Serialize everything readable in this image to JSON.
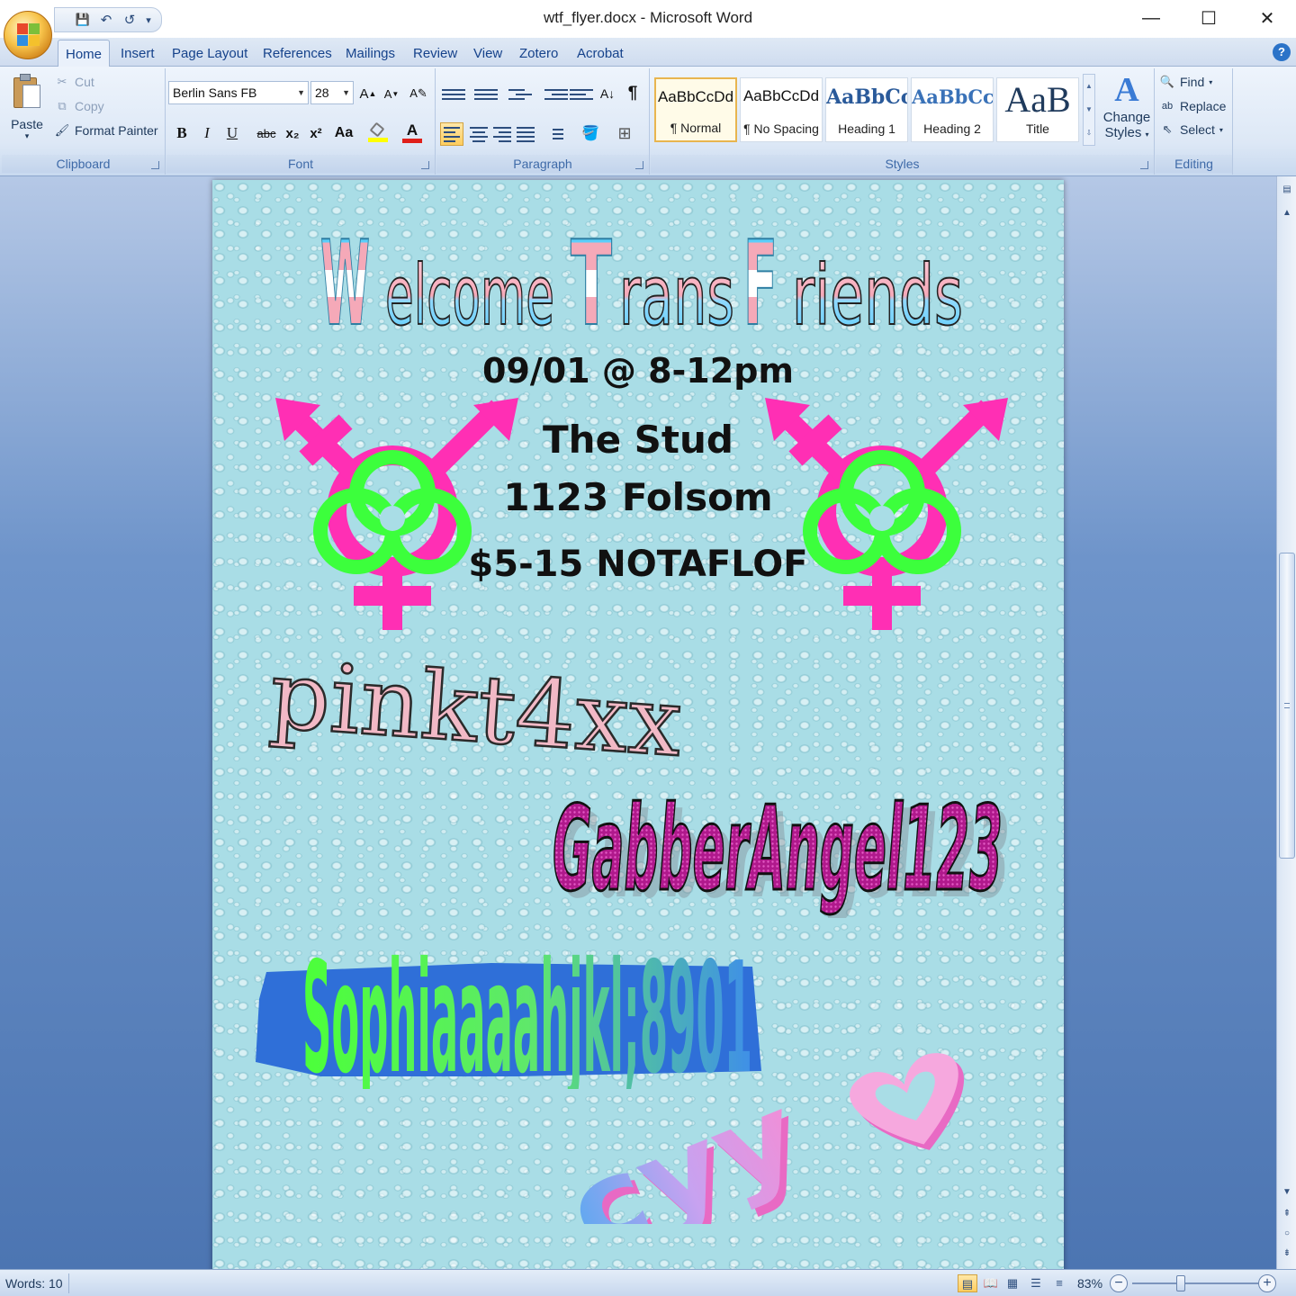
{
  "window": {
    "title": "wtf_flyer.docx - Microsoft Word",
    "minimize": "—",
    "maximize": "☐",
    "close": "✕"
  },
  "qat": {
    "save": "💾",
    "undo": "↶",
    "redo": "↺",
    "customize": "▾"
  },
  "tabs": [
    "Home",
    "Insert",
    "Page Layout",
    "References",
    "Mailings",
    "Review",
    "View",
    "Zotero",
    "Acrobat"
  ],
  "help_label": "?",
  "clipboard": {
    "paste": "Paste",
    "cut": "Cut",
    "copy": "Copy",
    "format_painter": "Format Painter",
    "group_label": "Clipboard"
  },
  "font": {
    "family": "Berlin Sans FB",
    "size": "28",
    "bold": "B",
    "italic": "I",
    "underline": "U",
    "strike": "abc",
    "subscript": "x₂",
    "superscript": "x²",
    "change_case": "Aa",
    "grow": "A",
    "shrink": "A",
    "group_label": "Font"
  },
  "paragraph": {
    "group_label": "Paragraph",
    "pilcrow": "¶"
  },
  "styles": {
    "group_label": "Styles",
    "items": [
      {
        "sample": "AaBbCcDd",
        "name": "¶ Normal"
      },
      {
        "sample": "AaBbCcDd",
        "name": "¶ No Spacing"
      },
      {
        "sample": "AaBbCc",
        "name": "Heading 1"
      },
      {
        "sample": "AaBbCc",
        "name": "Heading 2"
      },
      {
        "sample": "AaB",
        "name": "Title"
      }
    ],
    "change_styles_1": "Change",
    "change_styles_2": "Styles"
  },
  "editing": {
    "find": "Find",
    "replace": "Replace",
    "select": "Select",
    "group_label": "Editing"
  },
  "flyer": {
    "title_parts": [
      "W",
      "elcome ",
      "T",
      "rans ",
      "F",
      "riends"
    ],
    "date": "09/01 @ 8-12pm",
    "venue": "The Stud",
    "address": "1123 Folsom",
    "price": "$5-15 NOTAFLOF",
    "artists": [
      "pinkt4xx",
      "GabberAngel123",
      "Sophiaaaahjkl;8901",
      "cyy"
    ]
  },
  "status": {
    "words": "Words: 10",
    "zoom": "83%"
  },
  "colors": {
    "trans_blue": "#5bcefa",
    "trans_pink": "#f5a9b8",
    "symbol_magenta": "#ff2fb4",
    "symbol_green": "#3cff3c",
    "page_bg": "#a9dde6"
  }
}
